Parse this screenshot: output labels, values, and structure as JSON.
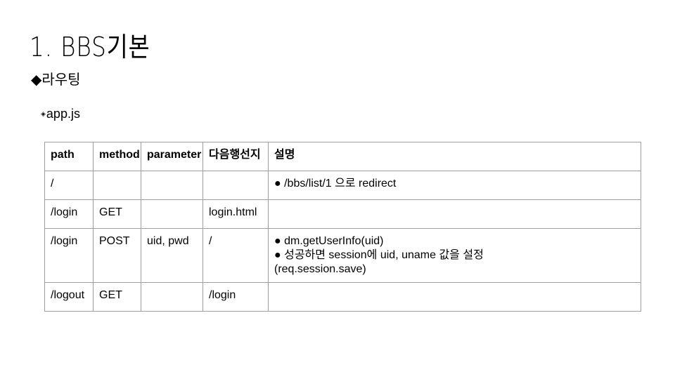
{
  "slide": {
    "title": "1.  BBS기본",
    "subtitle": "◆라우팅",
    "file_bullet": "◈",
    "file_name": "app.js"
  },
  "table": {
    "headers": [
      "path",
      "method",
      "parameter",
      "다음행선지",
      "설명"
    ],
    "rows": [
      {
        "path": "/",
        "method": "",
        "parameter": "",
        "next": "",
        "desc": [
          "● /bbs/list/1 으로 redirect"
        ]
      },
      {
        "path": "/login",
        "method": "GET",
        "parameter": "",
        "next": "login.html",
        "desc": []
      },
      {
        "path": "/login",
        "method": "POST",
        "parameter": "uid, pwd",
        "next": "/",
        "desc": [
          "● dm.getUserInfo(uid)",
          "● 성공하면 session에 uid, uname 값을 설정",
          "(req.session.save)"
        ]
      },
      {
        "path": "/logout",
        "method": "GET",
        "parameter": "",
        "next": "/login",
        "desc": []
      }
    ]
  }
}
